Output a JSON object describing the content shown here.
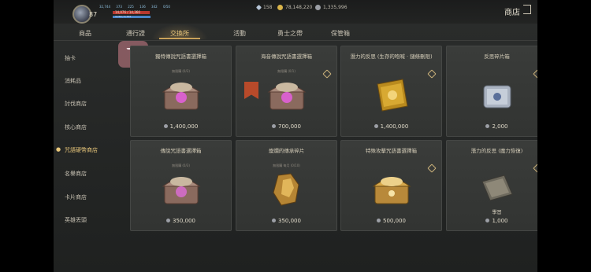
{
  "player": {
    "level": "87",
    "stats": [
      "32,744",
      "373",
      "225",
      "136",
      "342",
      "0/50"
    ],
    "hp": "14,076 / 14,360",
    "hp_ratio": 0.98,
    "mp": "3,753 / 3,753",
    "mp_ratio": 1.0
  },
  "currencies": [
    {
      "value": "158",
      "icon": "diamond-icon",
      "color": "#b7c6d8"
    },
    {
      "value": "78,148,220",
      "icon": "gold-coin-icon",
      "color": "#d9b44a"
    },
    {
      "value": "1,335,996",
      "icon": "silver-coin-icon",
      "color": "#9c9fa6"
    }
  ],
  "shop_title": "商店",
  "tabs": [
    "商品",
    "通行證",
    "交換所",
    "活動",
    "勇士之帶",
    "保管箱"
  ],
  "active_tab": 2,
  "sidebar": {
    "items": [
      "抽卡",
      "消耗品",
      "討伐商店",
      "核心商店",
      "咒語硬幣商店",
      "名譽商店",
      "卡片商店",
      "英雄丟頭"
    ],
    "active": 4
  },
  "cards": [
    {
      "title": "獨特傳說咒語書選擇箱",
      "sub": "無限購 (0/3)",
      "price": "1,400,000",
      "art": "chest-purple"
    },
    {
      "title": "海音傳說咒語書選擇箱",
      "sub": "無限購 (0/1)",
      "price": "700,000",
      "art": "chest-purple-banner"
    },
    {
      "title": "潛力的反思 (生存的咆喊 · 鏈條刪限)",
      "sub": "",
      "price": "1,400,000",
      "art": "gold-book"
    },
    {
      "title": "反思碎片箱",
      "sub": "",
      "price": "2,000",
      "art": "silver-chest"
    },
    {
      "title": "傳說咒語書選擇箱",
      "sub": "無限購 (0/3)",
      "price": "350,000",
      "art": "chest-purple"
    },
    {
      "title": "燦爛的傳承碎片",
      "sub": "無限購 每月 (0/10)",
      "price": "350,000",
      "art": "gold-shards"
    },
    {
      "title": "特殊攻擊咒語書選擇箱",
      "sub": "",
      "price": "500,000",
      "art": "chest-gold"
    },
    {
      "title": "潛力的反思 (魔力恢復)",
      "sub": "",
      "price": "1,000",
      "art": "grey-book",
      "extra": "學習"
    }
  ],
  "colors": {
    "accent": "#e9c77b",
    "panel": "#323432",
    "background": "#262827"
  }
}
